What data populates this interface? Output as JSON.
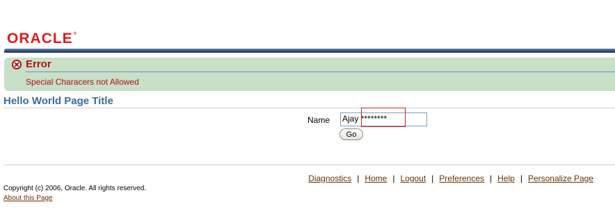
{
  "brand": {
    "logo_text": "ORACLE",
    "trademark": "®"
  },
  "message": {
    "title": "Error",
    "text": "Special Characers not Allowed",
    "icon": "error-icon"
  },
  "page": {
    "title": "Hello World Page Title"
  },
  "form": {
    "name_label": "Name",
    "name_value": "Ajay ********",
    "go_label": "Go"
  },
  "footer": {
    "links": [
      "Diagnostics",
      "Home",
      "Logout",
      "Preferences",
      "Help",
      "Personalize Page"
    ],
    "separator": "|",
    "copyright": "Copyright (c) 2006, Oracle. All rights reserved.",
    "about": "About this Page"
  },
  "colors": {
    "brand_red": "#e01c1c",
    "error_red": "#b01010",
    "message_bg": "#c8dfc8",
    "title_blue": "#3e6c94",
    "link_brown": "#663300"
  }
}
